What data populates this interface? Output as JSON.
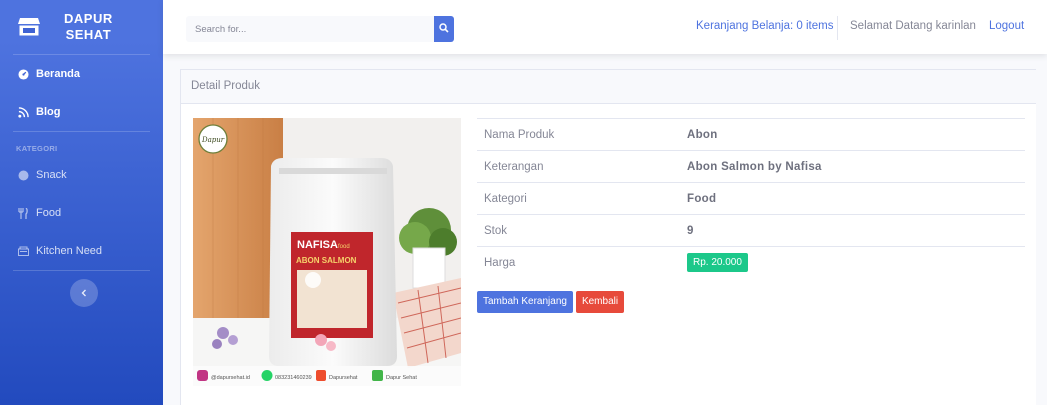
{
  "brand": {
    "line1": "DAPUR",
    "line2": "SEHAT",
    "icon": "store-icon"
  },
  "sidebar": {
    "items": [
      {
        "label": "Beranda",
        "icon": "tachometer-icon"
      },
      {
        "label": "Blog",
        "icon": "blog-icon"
      }
    ],
    "heading": "KATEGORI",
    "categories": [
      {
        "label": "Snack",
        "icon": "circle-icon"
      },
      {
        "label": "Food",
        "icon": "utensils-icon"
      },
      {
        "label": "Kitchen Need",
        "icon": "blender-icon"
      }
    ],
    "toggle_icon": "chevron-left-icon"
  },
  "topbar": {
    "search_placeholder": "Search for...",
    "search_icon": "search-icon",
    "cart_label": "Keranjang Belanja: 0 items",
    "welcome": "Selamat Datang karinlan",
    "logout": "Logout"
  },
  "card": {
    "title": "Detail Produk",
    "image_footer": {
      "instagram": "@dapursehat.id",
      "whatsapp": "083231460239",
      "shopee": "Dapursehat",
      "tokopedia": "Dapur Sehat"
    },
    "package": {
      "brand": "NAFISA",
      "brand_suffix": "food",
      "product": "ABON SALMON"
    },
    "details": [
      {
        "label": "Nama Produk",
        "value": "Abon"
      },
      {
        "label": "Keterangan",
        "value": "Abon Salmon by Nafisa"
      },
      {
        "label": "Kategori",
        "value": "Food"
      },
      {
        "label": "Stok",
        "value": "9"
      },
      {
        "label": "Harga",
        "value": "Rp. 20.000"
      }
    ],
    "buttons": {
      "add_cart": "Tambah Keranjang",
      "back": "Kembali"
    }
  },
  "colors": {
    "primary": "#4e73df",
    "success": "#1cc88a",
    "danger": "#e74a3b"
  }
}
